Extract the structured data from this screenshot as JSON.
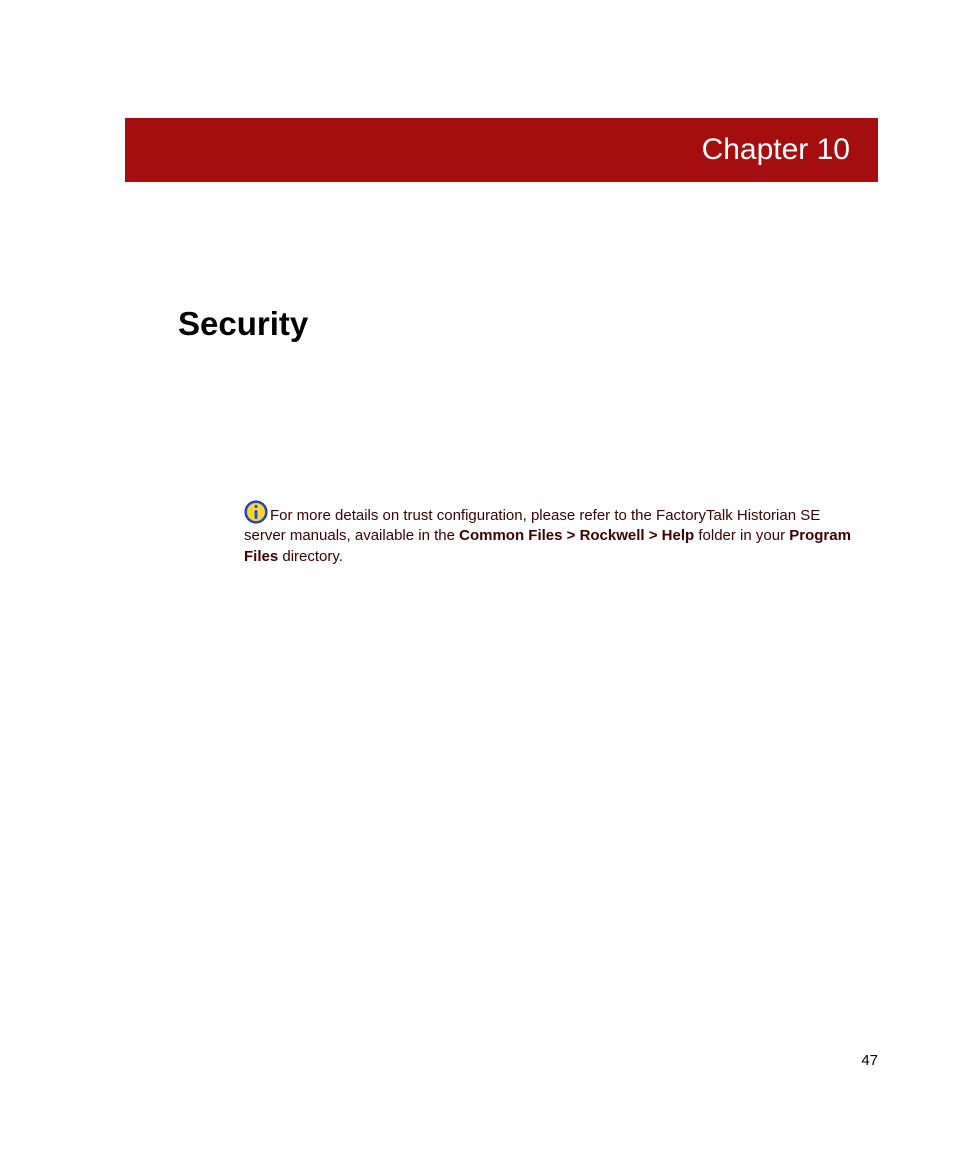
{
  "chapter": {
    "label": "Chapter 10"
  },
  "section": {
    "title": "Security"
  },
  "info": {
    "text_part1": "For more details on trust configuration, please refer to the FactoryTalk Historian SE server manuals, available in the ",
    "bold1": "Common Files > Rockwell > Help",
    "text_part2": " folder in your ",
    "bold2": "Program Files",
    "text_part3": " directory."
  },
  "page": {
    "number": "47"
  }
}
